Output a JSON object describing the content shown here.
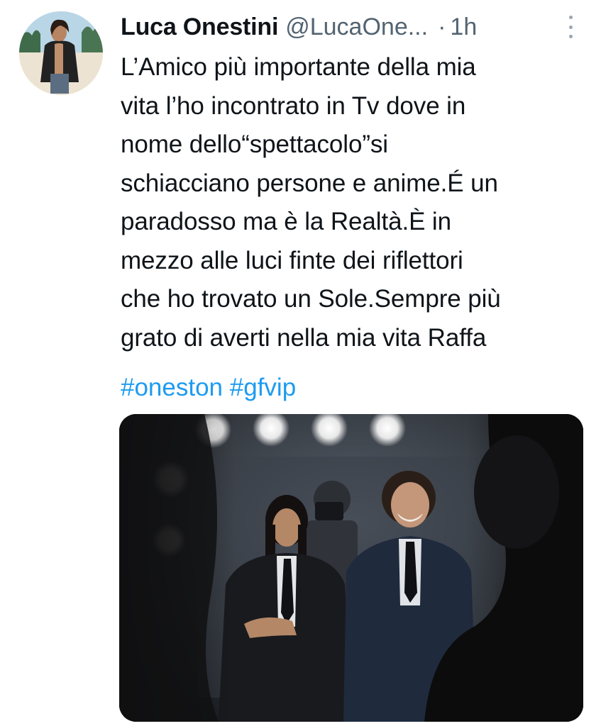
{
  "tweet": {
    "author_name": "Luca Onestini",
    "author_handle": "@LucaOne...",
    "separator": "·",
    "timestamp": "1h",
    "text_lines": [
      "L’Amico più importante della mia",
      "vita l’ho incontrato in Tv dove in",
      "nome dello“spettacolo”si",
      "schiacciano persone e anime.É un",
      "paradosso ma è la Realtà.È in",
      "mezzo alle luci finte dei riflettori",
      "che ho trovato un Sole.Sempre più",
      "grato di averti nella mia vita Raffa"
    ],
    "hashtags": [
      "#oneston",
      "#gfvip"
    ]
  },
  "icons": {
    "more": "more-vertical-icon",
    "avatar": "profile-avatar",
    "media": "photo-two-men-in-suits-mirror"
  },
  "colors": {
    "text": "#0f1419",
    "secondary": "#536471",
    "link": "#1d9bf0",
    "background": "#ffffff"
  }
}
